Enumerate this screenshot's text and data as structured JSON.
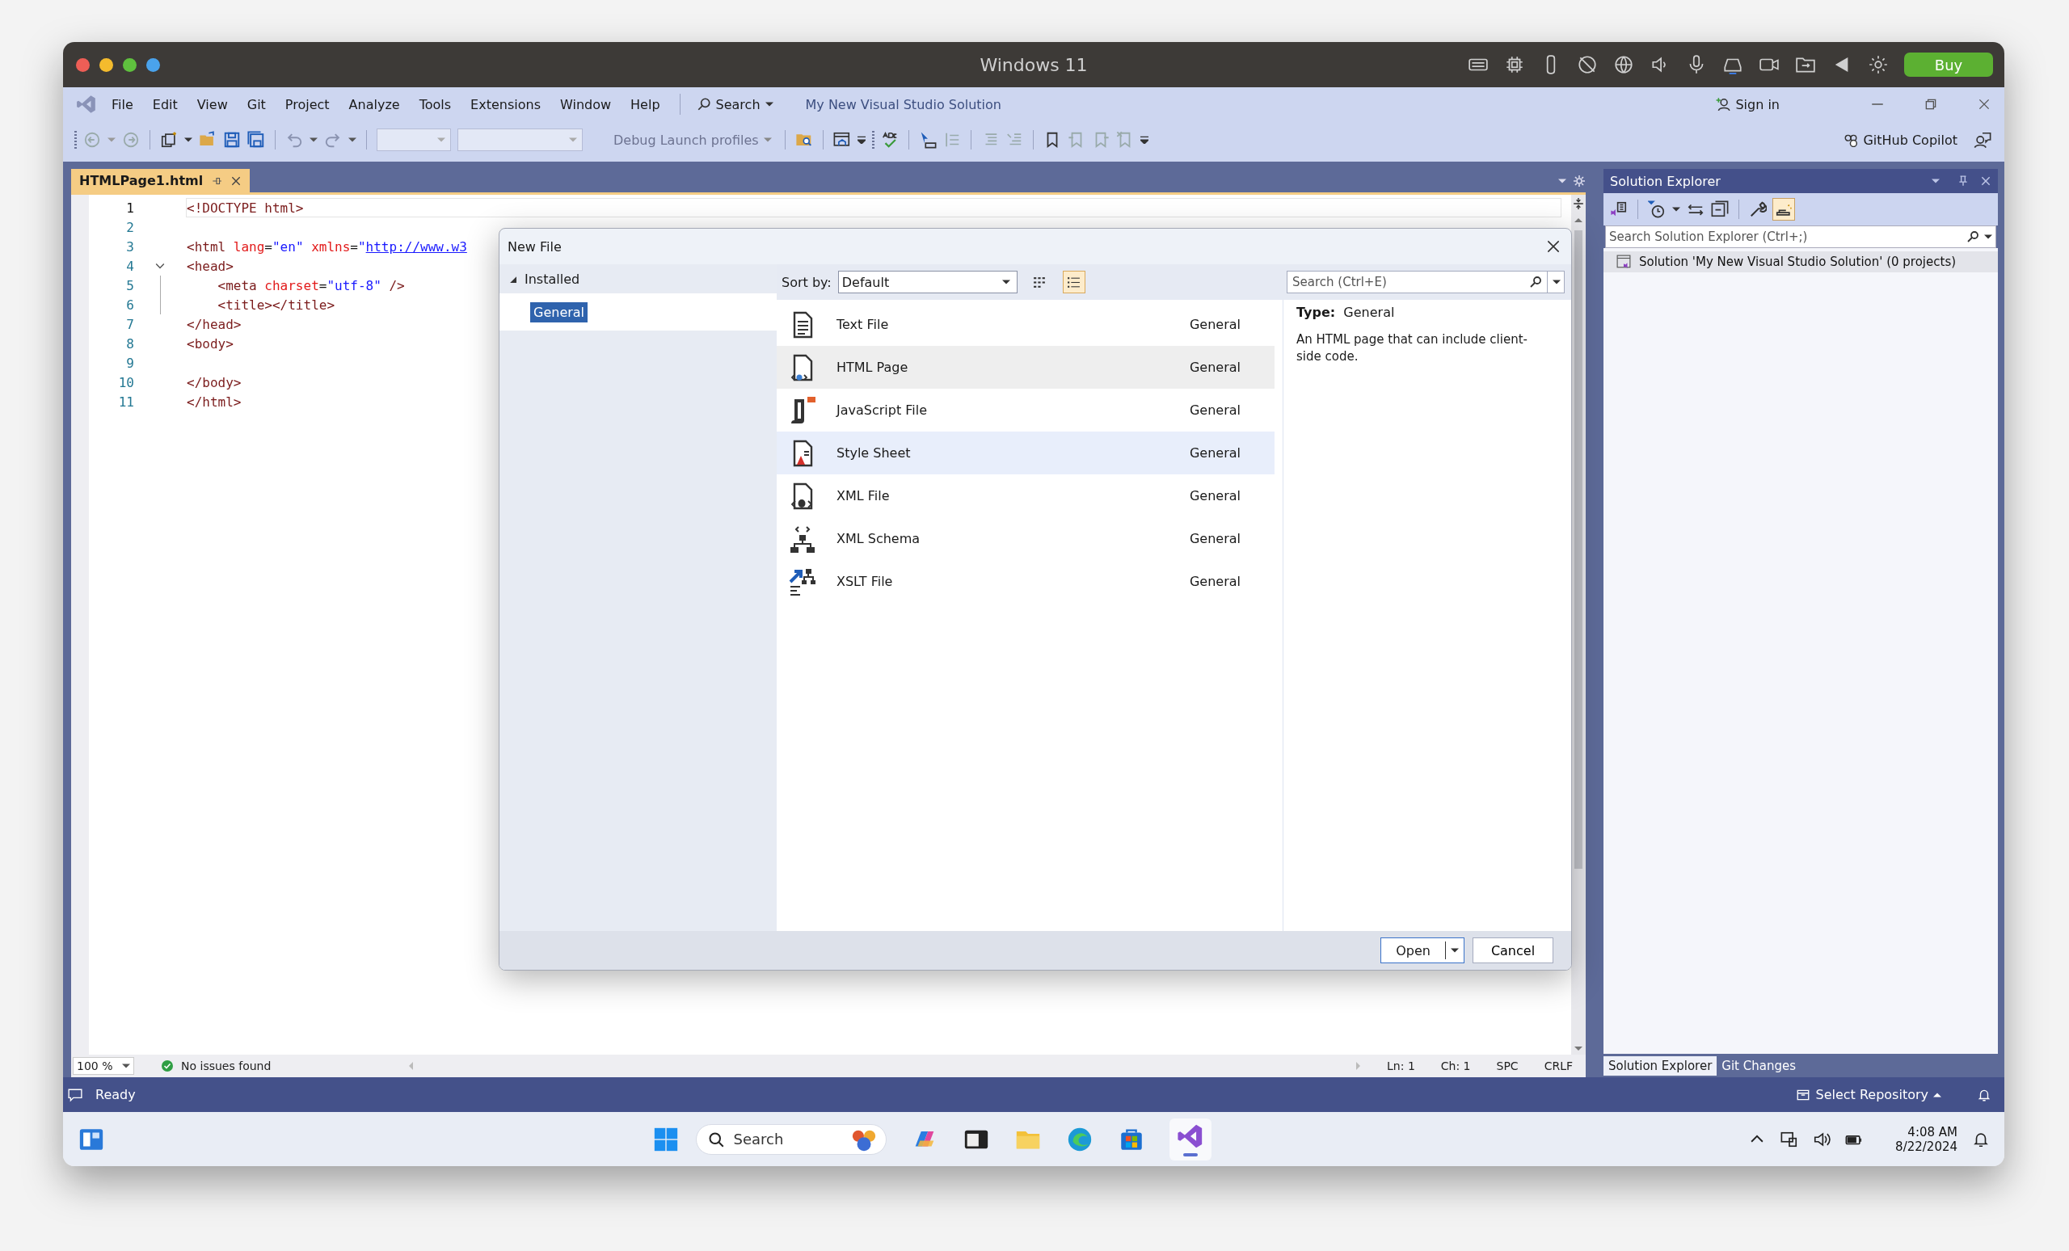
{
  "mac_window": {
    "title": "Windows 11",
    "buy_button": "Buy"
  },
  "menu_bar": {
    "items": [
      "File",
      "Edit",
      "View",
      "Git",
      "Project",
      "Analyze",
      "Tools",
      "Extensions",
      "Window",
      "Help"
    ],
    "search": "Search",
    "solution_name": "My New Visual Studio Solution",
    "sign_in": "Sign in"
  },
  "toolbar": {
    "debug_launch": "Debug Launch profiles",
    "copilot": "GitHub Copilot"
  },
  "editor": {
    "tab": {
      "label": "HTMLPage1.html",
      "selected": true
    },
    "lines": [
      {
        "number": "1",
        "current": true,
        "tokens": [
          {
            "kind": "tag",
            "text": "<!DOCTYPE html>"
          }
        ]
      },
      {
        "number": "2",
        "current": false
      },
      {
        "number": "3",
        "current": false,
        "tokens": [
          {
            "kind": "tag",
            "text": "<html"
          },
          {
            "kind": "attr",
            "text": " lang"
          },
          {
            "kind": "plain",
            "text": "="
          },
          {
            "kind": "value",
            "text": "\"en\""
          },
          {
            "kind": "attr",
            "text": " xmlns"
          },
          {
            "kind": "plain",
            "text": "="
          },
          {
            "kind": "value",
            "text": "\""
          },
          {
            "kind": "link",
            "text": "http://www.w3"
          }
        ]
      },
      {
        "number": "4",
        "current": false,
        "expanded": true,
        "tokens": [
          {
            "kind": "tag",
            "text": "<head>"
          }
        ]
      },
      {
        "number": "5",
        "current": false,
        "tokens": [
          {
            "kind": "tag",
            "text": "    <meta"
          },
          {
            "kind": "attr",
            "text": " charset"
          },
          {
            "kind": "plain",
            "text": "="
          },
          {
            "kind": "value",
            "text": "\"utf-8\""
          },
          {
            "kind": "tag",
            "text": " />"
          }
        ]
      },
      {
        "number": "6",
        "current": false,
        "tokens": [
          {
            "kind": "tag",
            "text": "    <title></title>"
          }
        ]
      },
      {
        "number": "7",
        "current": false,
        "tokens": [
          {
            "kind": "tag",
            "text": "</head>"
          }
        ]
      },
      {
        "number": "8",
        "current": false,
        "tokens": [
          {
            "kind": "tag",
            "text": "<body>"
          }
        ]
      },
      {
        "number": "9",
        "current": false
      },
      {
        "number": "10",
        "current": false,
        "tokens": [
          {
            "kind": "tag",
            "text": "</body>"
          }
        ]
      },
      {
        "number": "11",
        "current": false,
        "tokens": [
          {
            "kind": "tag",
            "text": "</html>"
          }
        ]
      }
    ],
    "zoom": "100 %",
    "issues": "No issues found",
    "position": [
      "Ln: 1",
      "Ch: 1",
      "SPC",
      "CRLF"
    ]
  },
  "dialog": {
    "title": "New File",
    "tree": [
      {
        "label": "Installed",
        "expanded": true,
        "children": [
          {
            "label": "General",
            "selected": true
          }
        ]
      }
    ],
    "sort_label": "Sort by:",
    "sort_value": "Default",
    "views": [
      {
        "kind": "grid",
        "selected": false
      },
      {
        "kind": "list",
        "selected": true
      }
    ],
    "search_placeholder": "Search (Ctrl+E)",
    "templates": [
      {
        "name": "Text File",
        "category": "General",
        "kind": "text",
        "selected": false,
        "hovered": false
      },
      {
        "name": "HTML Page",
        "category": "General",
        "kind": "html",
        "selected": true,
        "hovered": false
      },
      {
        "name": "JavaScript File",
        "category": "General",
        "kind": "js",
        "selected": false,
        "hovered": false
      },
      {
        "name": "Style Sheet",
        "category": "General",
        "kind": "css",
        "selected": false,
        "hovered": true
      },
      {
        "name": "XML File",
        "category": "General",
        "kind": "xml",
        "selected": false,
        "hovered": false
      },
      {
        "name": "XML Schema",
        "category": "General",
        "kind": "schema",
        "selected": false,
        "hovered": false
      },
      {
        "name": "XSLT File",
        "category": "General",
        "kind": "xslt",
        "selected": false,
        "hovered": false
      }
    ],
    "details": {
      "type_label": "Type:",
      "type_value": "General",
      "description": "An HTML page that can include client-side code."
    },
    "buttons": [
      "Open",
      "Cancel"
    ]
  },
  "solution_explorer": {
    "title": "Solution Explorer",
    "search_placeholder": "Search Solution Explorer (Ctrl+;)",
    "items": [
      {
        "label": "Solution 'My New Visual Studio Solution' (0 projects)"
      }
    ],
    "tabs": [
      {
        "label": "Solution Explorer",
        "selected": true
      },
      {
        "label": "Git Changes",
        "selected": false
      }
    ]
  },
  "status_bar": {
    "text": "Ready",
    "repository": "Select Repository"
  },
  "taskbar": {
    "search_placeholder": "Search",
    "time": "4:08 AM",
    "date": "8/22/2024"
  }
}
